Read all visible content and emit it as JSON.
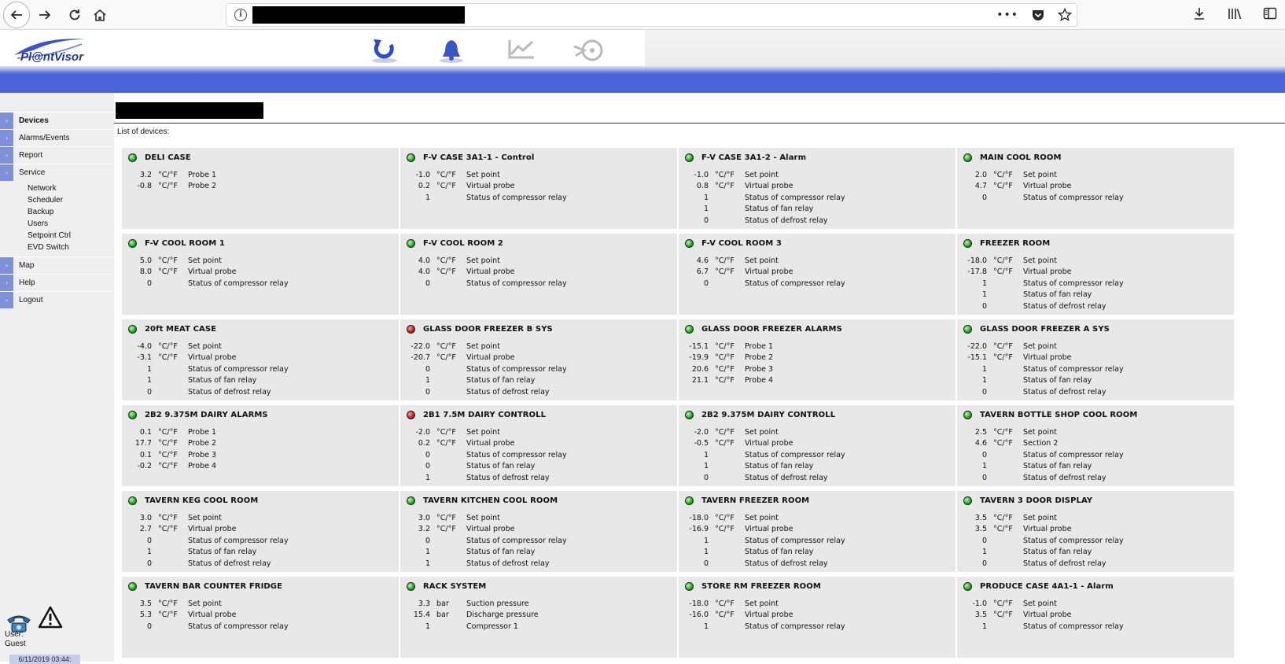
{
  "app": {
    "logo_text": "Pl@ntVisor"
  },
  "sidebar": {
    "menu": [
      {
        "label": "Devices",
        "active": true
      },
      {
        "label": "Alarms/Events"
      },
      {
        "label": "Report"
      },
      {
        "label": "Service"
      }
    ],
    "service_submenu": [
      "Network",
      "Scheduler",
      "Backup",
      "Users",
      "Setpoint Ctrl",
      "EVD Switch"
    ],
    "menu_after": [
      {
        "label": "Map"
      },
      {
        "label": "Help"
      },
      {
        "label": "Logout"
      }
    ],
    "user_label": "User:",
    "user_name": "Guest",
    "datetime": "6/11/2019 03:44:"
  },
  "main": {
    "list_label": "List of devices:"
  },
  "colors": {
    "accent_blue": "#4a63d8",
    "status_ok": "#1fa51f",
    "status_alarm": "#c01818"
  },
  "devices": [
    {
      "name": "DELI CASE",
      "status": "ok",
      "rows": [
        {
          "value": "3.2",
          "unit": "°C/°F",
          "desc": "Probe 1"
        },
        {
          "value": "-0.8",
          "unit": "°C/°F",
          "desc": "Probe 2"
        }
      ]
    },
    {
      "name": "F-V CASE 3A1-1 - Control",
      "status": "ok",
      "rows": [
        {
          "value": "-1.0",
          "unit": "°C/°F",
          "desc": "Set point"
        },
        {
          "value": "0.2",
          "unit": "°C/°F",
          "desc": "Virtual probe"
        },
        {
          "value": "1",
          "unit": "",
          "desc": "Status of compressor relay"
        }
      ]
    },
    {
      "name": "F-V CASE 3A1-2 - Alarm",
      "status": "ok",
      "rows": [
        {
          "value": "-1.0",
          "unit": "°C/°F",
          "desc": "Set point"
        },
        {
          "value": "0.8",
          "unit": "°C/°F",
          "desc": "Virtual probe"
        },
        {
          "value": "1",
          "unit": "",
          "desc": "Status of compressor relay"
        },
        {
          "value": "1",
          "unit": "",
          "desc": "Status of fan relay"
        },
        {
          "value": "0",
          "unit": "",
          "desc": "Status of defrost relay"
        }
      ]
    },
    {
      "name": "MAIN COOL ROOM",
      "status": "ok",
      "rows": [
        {
          "value": "2.0",
          "unit": "°C/°F",
          "desc": "Set point"
        },
        {
          "value": "4.7",
          "unit": "°C/°F",
          "desc": "Virtual probe"
        },
        {
          "value": "0",
          "unit": "",
          "desc": "Status of compressor relay"
        }
      ]
    },
    {
      "name": "F-V COOL ROOM 1",
      "status": "ok",
      "rows": [
        {
          "value": "5.0",
          "unit": "°C/°F",
          "desc": "Set point"
        },
        {
          "value": "8.0",
          "unit": "°C/°F",
          "desc": "Virtual probe"
        },
        {
          "value": "0",
          "unit": "",
          "desc": "Status of compressor relay"
        }
      ]
    },
    {
      "name": "F-V COOL ROOM 2",
      "status": "ok",
      "rows": [
        {
          "value": "4.0",
          "unit": "°C/°F",
          "desc": "Set point"
        },
        {
          "value": "4.0",
          "unit": "°C/°F",
          "desc": "Virtual probe"
        },
        {
          "value": "0",
          "unit": "",
          "desc": "Status of compressor relay"
        }
      ]
    },
    {
      "name": "F-V COOL ROOM 3",
      "status": "ok",
      "rows": [
        {
          "value": "4.6",
          "unit": "°C/°F",
          "desc": "Set point"
        },
        {
          "value": "6.7",
          "unit": "°C/°F",
          "desc": "Virtual probe"
        },
        {
          "value": "0",
          "unit": "",
          "desc": "Status of compressor relay"
        }
      ]
    },
    {
      "name": "FREEZER ROOM",
      "status": "ok",
      "rows": [
        {
          "value": "-18.0",
          "unit": "°C/°F",
          "desc": "Set point"
        },
        {
          "value": "-17.8",
          "unit": "°C/°F",
          "desc": "Virtual probe"
        },
        {
          "value": "1",
          "unit": "",
          "desc": "Status of compressor relay"
        },
        {
          "value": "1",
          "unit": "",
          "desc": "Status of fan relay"
        },
        {
          "value": "0",
          "unit": "",
          "desc": "Status of defrost relay"
        }
      ]
    },
    {
      "name": "20ft MEAT CASE",
      "status": "ok",
      "rows": [
        {
          "value": "-4.0",
          "unit": "°C/°F",
          "desc": "Set point"
        },
        {
          "value": "-3.1",
          "unit": "°C/°F",
          "desc": "Virtual probe"
        },
        {
          "value": "1",
          "unit": "",
          "desc": "Status of compressor relay"
        },
        {
          "value": "1",
          "unit": "",
          "desc": "Status of fan relay"
        },
        {
          "value": "0",
          "unit": "",
          "desc": "Status of defrost relay"
        }
      ]
    },
    {
      "name": "GLASS DOOR FREEZER B SYS",
      "status": "alarm",
      "rows": [
        {
          "value": "-22.0",
          "unit": "°C/°F",
          "desc": "Set point"
        },
        {
          "value": "-20.7",
          "unit": "°C/°F",
          "desc": "Virtual probe"
        },
        {
          "value": "0",
          "unit": "",
          "desc": "Status of compressor relay"
        },
        {
          "value": "1",
          "unit": "",
          "desc": "Status of fan relay"
        },
        {
          "value": "0",
          "unit": "",
          "desc": "Status of defrost relay"
        }
      ]
    },
    {
      "name": "GLASS DOOR FREEZER ALARMS",
      "status": "ok",
      "rows": [
        {
          "value": "-15.1",
          "unit": "°C/°F",
          "desc": "Probe 1"
        },
        {
          "value": "-19.9",
          "unit": "°C/°F",
          "desc": "Probe 2"
        },
        {
          "value": "20.6",
          "unit": "°C/°F",
          "desc": "Probe 3"
        },
        {
          "value": "21.1",
          "unit": "°C/°F",
          "desc": "Probe 4"
        }
      ]
    },
    {
      "name": "GLASS DOOR FREEZER A SYS",
      "status": "ok",
      "rows": [
        {
          "value": "-22.0",
          "unit": "°C/°F",
          "desc": "Set point"
        },
        {
          "value": "-15.1",
          "unit": "°C/°F",
          "desc": "Virtual probe"
        },
        {
          "value": "1",
          "unit": "",
          "desc": "Status of compressor relay"
        },
        {
          "value": "1",
          "unit": "",
          "desc": "Status of fan relay"
        },
        {
          "value": "0",
          "unit": "",
          "desc": "Status of defrost relay"
        }
      ]
    },
    {
      "name": "2B2 9.375M DAIRY ALARMS",
      "status": "ok",
      "rows": [
        {
          "value": "0.1",
          "unit": "°C/°F",
          "desc": "Probe 1"
        },
        {
          "value": "17.7",
          "unit": "°C/°F",
          "desc": "Probe 2"
        },
        {
          "value": "0.1",
          "unit": "°C/°F",
          "desc": "Probe 3"
        },
        {
          "value": "-0.2",
          "unit": "°C/°F",
          "desc": "Probe 4"
        }
      ]
    },
    {
      "name": "2B1 7.5M DAIRY CONTROLL",
      "status": "alarm",
      "rows": [
        {
          "value": "-2.0",
          "unit": "°C/°F",
          "desc": "Set point"
        },
        {
          "value": "0.2",
          "unit": "°C/°F",
          "desc": "Virtual probe"
        },
        {
          "value": "0",
          "unit": "",
          "desc": "Status of compressor relay"
        },
        {
          "value": "0",
          "unit": "",
          "desc": "Status of fan relay"
        },
        {
          "value": "1",
          "unit": "",
          "desc": "Status of defrost relay"
        }
      ]
    },
    {
      "name": "2B2 9.375M DAIRY CONTROLL",
      "status": "ok",
      "rows": [
        {
          "value": "-2.0",
          "unit": "°C/°F",
          "desc": "Set point"
        },
        {
          "value": "-0.5",
          "unit": "°C/°F",
          "desc": "Virtual probe"
        },
        {
          "value": "1",
          "unit": "",
          "desc": "Status of compressor relay"
        },
        {
          "value": "1",
          "unit": "",
          "desc": "Status of fan relay"
        },
        {
          "value": "0",
          "unit": "",
          "desc": "Status of defrost relay"
        }
      ]
    },
    {
      "name": "TAVERN BOTTLE SHOP COOL ROOM",
      "status": "ok",
      "rows": [
        {
          "value": "2.5",
          "unit": "°C/°F",
          "desc": "Set point"
        },
        {
          "value": "4.6",
          "unit": "°C/°F",
          "desc": "Section 2"
        },
        {
          "value": "0",
          "unit": "",
          "desc": "Status of compressor relay"
        },
        {
          "value": "1",
          "unit": "",
          "desc": "Status of fan relay"
        },
        {
          "value": "0",
          "unit": "",
          "desc": "Status of defrost relay"
        }
      ]
    },
    {
      "name": "TAVERN KEG COOL ROOM",
      "status": "ok",
      "rows": [
        {
          "value": "3.0",
          "unit": "°C/°F",
          "desc": "Set point"
        },
        {
          "value": "2.7",
          "unit": "°C/°F",
          "desc": "Virtual probe"
        },
        {
          "value": "0",
          "unit": "",
          "desc": "Status of compressor relay"
        },
        {
          "value": "1",
          "unit": "",
          "desc": "Status of fan relay"
        },
        {
          "value": "0",
          "unit": "",
          "desc": "Status of defrost relay"
        }
      ]
    },
    {
      "name": "TAVERN KITCHEN COOL ROOM",
      "status": "ok",
      "rows": [
        {
          "value": "3.0",
          "unit": "°C/°F",
          "desc": "Set point"
        },
        {
          "value": "3.2",
          "unit": "°C/°F",
          "desc": "Virtual probe"
        },
        {
          "value": "0",
          "unit": "",
          "desc": "Status of compressor relay"
        },
        {
          "value": "1",
          "unit": "",
          "desc": "Status of fan relay"
        },
        {
          "value": "1",
          "unit": "",
          "desc": "Status of defrost relay"
        }
      ]
    },
    {
      "name": "TAVERN FREEZER ROOM",
      "status": "ok",
      "rows": [
        {
          "value": "-18.0",
          "unit": "°C/°F",
          "desc": "Set point"
        },
        {
          "value": "-16.9",
          "unit": "°C/°F",
          "desc": "Virtual probe"
        },
        {
          "value": "1",
          "unit": "",
          "desc": "Status of compressor relay"
        },
        {
          "value": "1",
          "unit": "",
          "desc": "Status of fan relay"
        },
        {
          "value": "0",
          "unit": "",
          "desc": "Status of defrost relay"
        }
      ]
    },
    {
      "name": "TAVERN 3 DOOR DISPLAY",
      "status": "ok",
      "rows": [
        {
          "value": "3.5",
          "unit": "°C/°F",
          "desc": "Set point"
        },
        {
          "value": "3.5",
          "unit": "°C/°F",
          "desc": "Virtual probe"
        },
        {
          "value": "0",
          "unit": "",
          "desc": "Status of compressor relay"
        },
        {
          "value": "1",
          "unit": "",
          "desc": "Status of fan relay"
        },
        {
          "value": "0",
          "unit": "",
          "desc": "Status of defrost relay"
        }
      ]
    },
    {
      "name": "TAVERN BAR COUNTER FRIDGE",
      "status": "ok",
      "rows": [
        {
          "value": "3.5",
          "unit": "°C/°F",
          "desc": "Set point"
        },
        {
          "value": "5.3",
          "unit": "°C/°F",
          "desc": "Virtual probe"
        },
        {
          "value": "0",
          "unit": "",
          "desc": "Status of compressor relay"
        }
      ]
    },
    {
      "name": "RACK SYSTEM",
      "status": "ok",
      "rows": [
        {
          "value": "3.3",
          "unit": "bar",
          "desc": "Suction pressure"
        },
        {
          "value": "15.4",
          "unit": "bar",
          "desc": "Discharge pressure"
        },
        {
          "value": "1",
          "unit": "",
          "desc": "Compressor 1"
        }
      ]
    },
    {
      "name": "STORE RM FREEZER ROOM",
      "status": "ok",
      "rows": [
        {
          "value": "-18.0",
          "unit": "°C/°F",
          "desc": "Set point"
        },
        {
          "value": "-16.0",
          "unit": "°C/°F",
          "desc": "Virtual probe"
        },
        {
          "value": "1",
          "unit": "",
          "desc": "Status of compressor relay"
        }
      ]
    },
    {
      "name": "PRODUCE CASE 4A1-1 - Alarm",
      "status": "ok",
      "rows": [
        {
          "value": "-1.0",
          "unit": "°C/°F",
          "desc": "Set point"
        },
        {
          "value": "3.5",
          "unit": "°C/°F",
          "desc": "Virtual probe"
        },
        {
          "value": "1",
          "unit": "",
          "desc": "Status of compressor relay"
        }
      ]
    }
  ]
}
